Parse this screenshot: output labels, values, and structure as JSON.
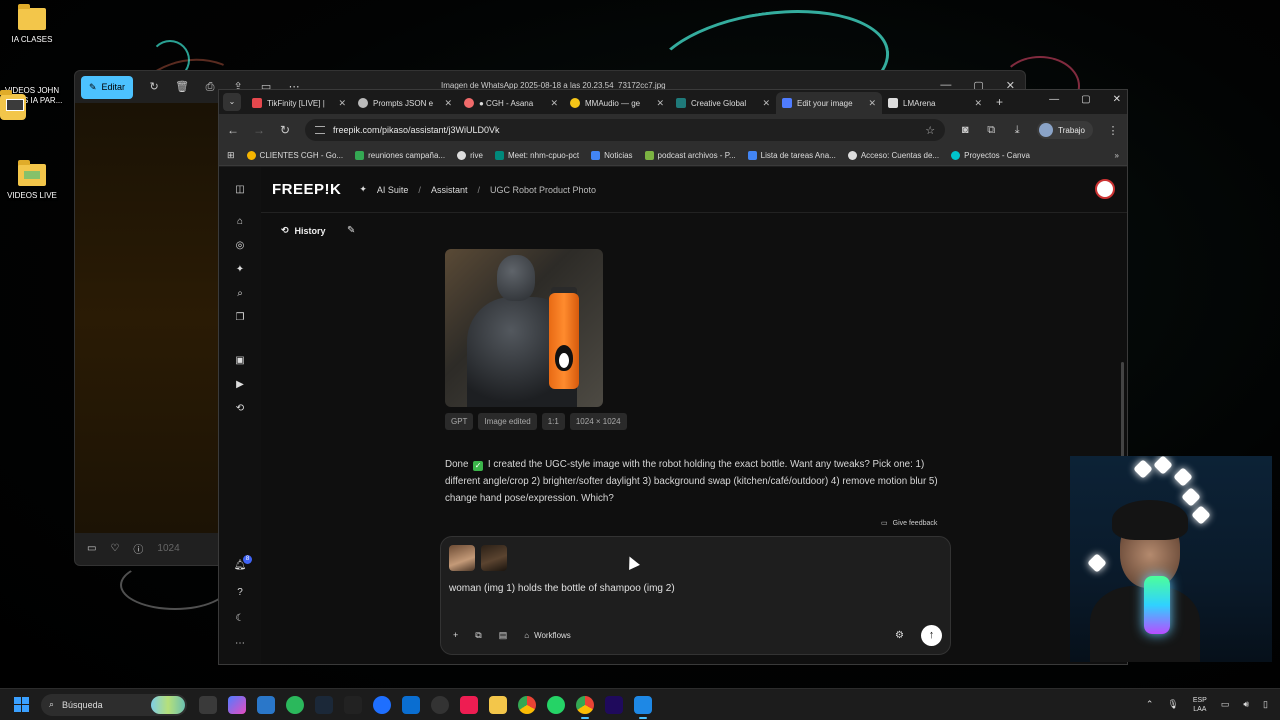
{
  "desktop": {
    "icons": [
      {
        "label": "IA CLASES",
        "icon": "folder-icon"
      },
      {
        "label": "VIDEOS JOHN ROJAS IA PAR...",
        "icon": "folder-icon"
      },
      {
        "label": "VIDEOS LIVE",
        "icon": "folder-icon"
      }
    ]
  },
  "photo_viewer": {
    "edit_label": "Editar",
    "title": "Imagen de WhatsApp 2025-08-18 a las 20.23.54_73172cc7.jpg",
    "zoom_label": "1024"
  },
  "browser": {
    "tabs": [
      {
        "title": "TikFinity [LIVE] |",
        "favicon_color": "#e5484d",
        "active": false
      },
      {
        "title": "Prompts JSON e",
        "favicon_color": "#bbbbbb",
        "active": false
      },
      {
        "title": "● CGH - Asana",
        "favicon_color": "#f06a6a",
        "active": false
      },
      {
        "title": "MMAudio — ge",
        "favicon_color": "#f5c518",
        "active": false
      },
      {
        "title": "Creative Global",
        "favicon_color": "#1f7a7a",
        "active": false
      },
      {
        "title": "Edit your image",
        "favicon_color": "#4f7cff",
        "active": true
      },
      {
        "title": "LMArena",
        "favicon_color": "#dddddd",
        "active": false
      }
    ],
    "url": "freepik.com/pikaso/assistant/j3WiULD0Vk",
    "profile_label": "Trabajo",
    "bookmarks": [
      {
        "label": "CLIENTES CGH - Go...",
        "color": "#f5b400"
      },
      {
        "label": "reuniones campaña...",
        "color": "#34a853"
      },
      {
        "label": "rive",
        "color": "#dddddd"
      },
      {
        "label": "Meet: nhm-cpuo-pct",
        "color": "#00897b"
      },
      {
        "label": "Noticias",
        "color": "#4285f4"
      },
      {
        "label": "podcast archivos - P...",
        "color": "#7cb342"
      },
      {
        "label": "Lista de tareas Ana...",
        "color": "#4285f4"
      },
      {
        "label": "Acceso: Cuentas de...",
        "color": "#dddddd"
      },
      {
        "label": "Proyectos - Canva",
        "color": "#00c4cc"
      }
    ]
  },
  "freepik": {
    "logo": "FREEP!K",
    "breadcrumb": [
      "AI Suite",
      "Assistant",
      "UGC Robot Product Photo"
    ],
    "history_label": "History",
    "image_chips": [
      "GPT",
      "Image edited",
      "1:1",
      "1024 × 1024"
    ],
    "message_before": "Done",
    "message_after": "I created the UGC-style image with the robot holding the exact bottle. Want any tweaks? Pick one: 1) different angle/crop 2) brighter/softer daylight 3) background swap (kitchen/café/outdoor) 4) remove motion blur 5) change hand pose/expression. Which?",
    "feedback_label": "Give feedback",
    "prompt_text": "woman (img 1) holds the bottle of shampoo (img 2)",
    "workflows_label": "Workflows",
    "notification_count": "8"
  },
  "taskbar": {
    "search_label": "Búsqueda",
    "lang_top": "ESP",
    "lang_bottom": "LAA"
  }
}
